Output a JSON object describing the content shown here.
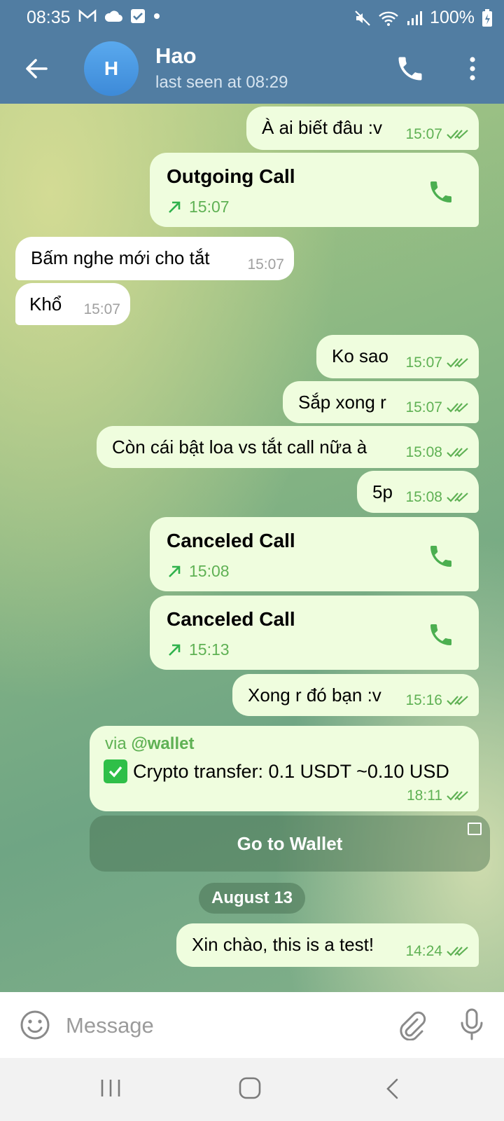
{
  "status_bar": {
    "time": "08:35",
    "battery": "100%",
    "icons": [
      "gmail-icon",
      "cloud-icon",
      "check-square-icon",
      "dot-icon",
      "mute-icon",
      "wifi-icon",
      "signal-icon",
      "battery-charging-icon"
    ]
  },
  "header": {
    "avatar_initial": "H",
    "name": "Hao",
    "status": "last seen at 08:29",
    "colors": {
      "bar": "#517da2",
      "avatar": "#4a97e3"
    }
  },
  "messages": [
    {
      "dir": "out",
      "text": "À ai biết đâu :v",
      "time": "15:07"
    },
    {
      "dir": "out",
      "type": "call",
      "title": "Outgoing Call",
      "time": "15:07"
    },
    {
      "dir": "in",
      "text": "Bấm nghe mới cho tắt",
      "time": "15:07"
    },
    {
      "dir": "in",
      "text": "Khổ",
      "time": "15:07"
    },
    {
      "dir": "out",
      "text": "Ko sao",
      "time": "15:07"
    },
    {
      "dir": "out",
      "text": "Sắp xong r",
      "time": "15:07"
    },
    {
      "dir": "out",
      "text": "Còn cái bật loa vs tắt call nữa à",
      "time": "15:08"
    },
    {
      "dir": "out",
      "text": "5p",
      "time": "15:08"
    },
    {
      "dir": "out",
      "type": "call",
      "title": "Canceled Call",
      "time": "15:08"
    },
    {
      "dir": "out",
      "type": "call",
      "title": "Canceled Call",
      "time": "15:13"
    },
    {
      "dir": "out",
      "text": "Xong r đó bạn :v",
      "time": "15:16"
    },
    {
      "dir": "out",
      "type": "bot",
      "via_prefix": "via ",
      "via_bot": "@wallet",
      "text": "Crypto transfer: 0.1 USDT ~0.10 USD",
      "time": "18:11"
    },
    {
      "dir": "out",
      "text": "Xin chào, this is a test!",
      "time": "14:24"
    }
  ],
  "wallet_button": {
    "label": "Go to Wallet"
  },
  "date_separator": "August 13",
  "input": {
    "placeholder": "Message",
    "value": ""
  },
  "colors": {
    "outgoing_bubble": "#effdde",
    "incoming_bubble": "#ffffff",
    "accent_green": "#5fb154"
  }
}
